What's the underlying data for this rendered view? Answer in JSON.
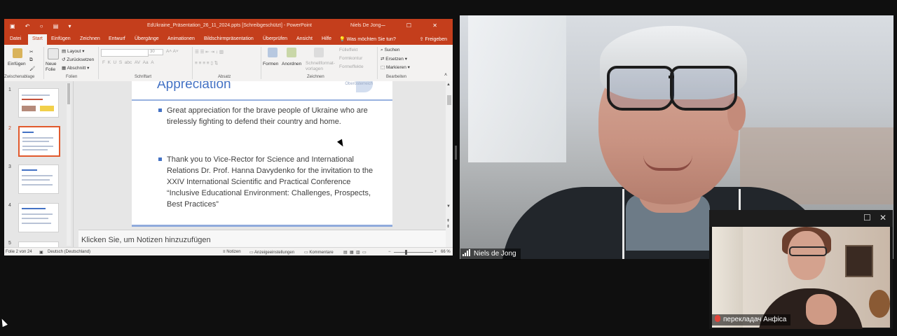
{
  "powerpoint": {
    "window_title": "EdUkraine_Präsentation_26_11_2024.ppts [Schreibgeschützt] - PowerPoint",
    "user_name": "Niels De Jong",
    "ribbon_tabs": [
      "Datei",
      "Start",
      "Einfügen",
      "Zeichnen",
      "Entwurf",
      "Übergänge",
      "Animationen",
      "Bildschirmpräsentation",
      "Überprüfen",
      "Ansicht",
      "Hilfe"
    ],
    "active_tab": "Start",
    "tell_me": "Was möchten Sie tun?",
    "share": "Freigeben",
    "ribbon": {
      "paste": "Einfügen",
      "clipboard_group": "Zwischenablage",
      "new_slide": "Neue Folie",
      "layout": "Layout",
      "reset": "Zurücksetzen",
      "section": "Abschnitt",
      "slides_group": "Folien",
      "font_size": "30",
      "font_group": "Schriftart",
      "paragraph_group": "Absatz",
      "shapes": "Formen",
      "arrange": "Anordnen",
      "quick_styles": "Schnellformat-vorlagen",
      "fill": "Fülleffekt",
      "outline": "Formkontur",
      "effects": "Formeffekte",
      "drawing_group": "Zeichnen",
      "find": "Suchen",
      "replace": "Ersetzen",
      "select": "Markieren",
      "editing_group": "Bearbeiten"
    },
    "thumbnails": [
      {
        "number": "1",
        "active": false
      },
      {
        "number": "2",
        "active": true
      },
      {
        "number": "3",
        "active": false
      },
      {
        "number": "4",
        "active": false
      },
      {
        "number": "5",
        "active": false
      }
    ],
    "slide": {
      "title": "Appreciation",
      "logo_text": "Pädagogische Hochschule Oberösterreich",
      "bullets": [
        "Great appreciation for the brave people of Ukraine who are tirelessly fighting to defend their country and home.",
        "Thank you to Vice-Rector for Science and International Relations Dr. Prof. Hanna Davydenko for the invitation to the XXIV International Scientific and Practical Conference “Inclusive Educational Environment: Challenges, Prospects, Best Practices”"
      ]
    },
    "notes_placeholder": "Klicken Sie, um Notizen hinzuzufügen",
    "status": {
      "slide_count": "Folie 2 von 24",
      "language": "Deutsch (Deutschland)",
      "notes": "Notizen",
      "display_settings": "Anzeigeeinstellungen",
      "comments": "Kommentare",
      "zoom": "66 %"
    }
  },
  "video_main": {
    "participant_name": "Niels de Jong"
  },
  "video_small": {
    "participant_name": "перекладач Анфіса"
  },
  "colors": {
    "ppt_accent": "#c43e1c",
    "slide_blue": "#4472c4",
    "mic_muted": "#e2453b"
  }
}
